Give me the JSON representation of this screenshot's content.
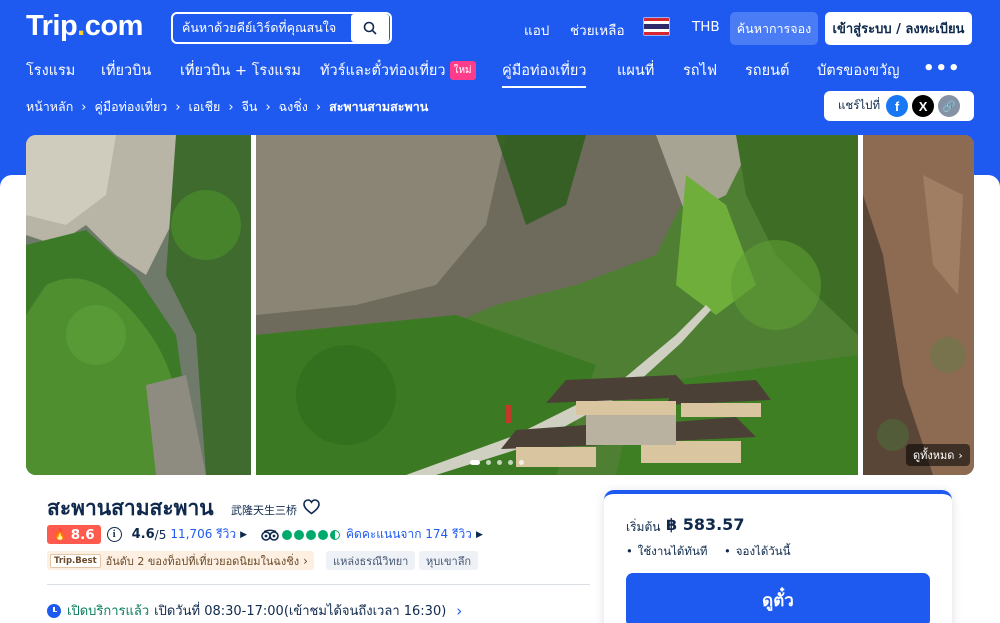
{
  "header": {
    "logo_main": "Trip",
    "logo_dot": ".",
    "logo_tld": "com",
    "search_placeholder": "ค้นหาด้วยคีย์เวิร์ดที่คุณสนใจ",
    "app_label": "แอป",
    "help_label": "ช่วยเหลือ",
    "currency": "THB",
    "booking_search_label": "ค้นหาการจอง",
    "login_label": "เข้าสู่ระบบ / ลงทะเบียน"
  },
  "categories": [
    {
      "label": "โรงแรม"
    },
    {
      "label": "เที่ยวบิน"
    },
    {
      "label": "เที่ยวบิน + โรงแรม"
    },
    {
      "label": "ทัวร์และตั๋วท่องเที่ยว",
      "badge": "ใหม่"
    },
    {
      "label": "คู่มือท่องเที่ยว",
      "active": true
    },
    {
      "label": "แผนที่"
    },
    {
      "label": "รถไฟ"
    },
    {
      "label": "รถยนต์"
    },
    {
      "label": "บัตรของขวัญ"
    }
  ],
  "more_label": "•••",
  "breadcrumb": [
    "หน้าหลัก",
    "คู่มือท่องเที่ยว",
    "เอเชีย",
    "จีน",
    "ฉงชิ่ง",
    "สะพานสามสะพาน"
  ],
  "share": {
    "label": "แชร์ไปที่",
    "facebook": "f",
    "x": "X",
    "link": "🔗"
  },
  "gallery": {
    "view_all": "ดูทั้งหมด",
    "dots": 5,
    "active_dot": 0
  },
  "attraction": {
    "title": "สะพานสามสะพาน",
    "subtitle": "武隆天生三桥",
    "score": "8.6",
    "review_score": "4.6",
    "review_scale": "/5",
    "review_count": "11,706 รีวิว",
    "ta_rating": 4.5,
    "ta_text": "คิดคะแนนจาก 174 รีวิว",
    "rank_logo": "Trip.Best",
    "rank_text": "อันดับ 2 ของท็อปที่เที่ยวยอดนิยมในฉงชิ่ง",
    "tags": [
      "แหล่งธรณีวิทยา",
      "หุบเขาลึก"
    ],
    "open_status": "เปิดบริการแล้ว",
    "hours": "เปิดวันที่ 08:30-17:00(เข้าชมได้จนถึงเวลา 16:30)"
  },
  "price_card": {
    "from_label": "เริ่มต้น",
    "price": "฿ 583.57",
    "features": [
      "ใช้งานได้ทันที",
      "จองได้วันนี้"
    ],
    "cta": "ดูตั๋ว"
  },
  "colors": {
    "brand": "#1f5af0",
    "navy": "#0f294d",
    "score": "#ff5a4e",
    "tripadvisor": "#00aa6c"
  }
}
